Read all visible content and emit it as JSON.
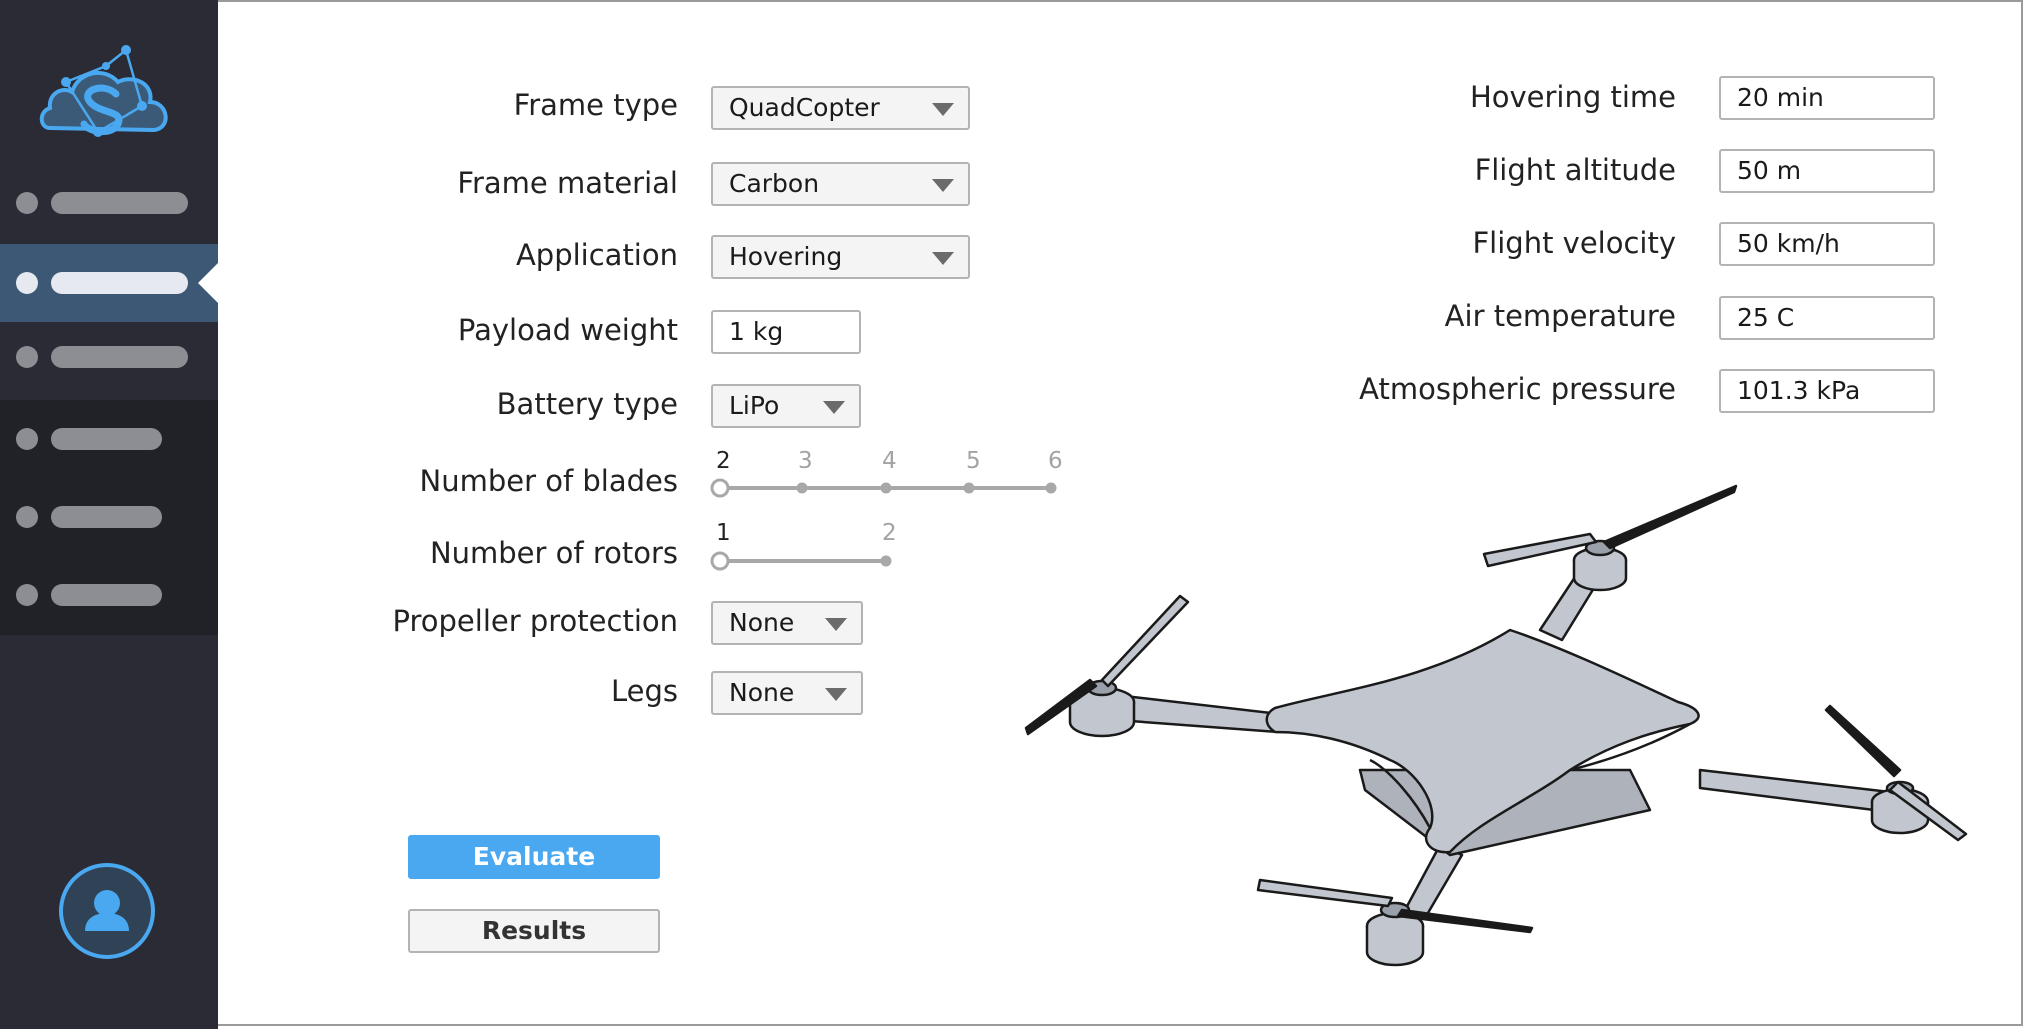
{
  "sidebar": {
    "items": [
      {
        "id": "nav-1",
        "active": false
      },
      {
        "id": "nav-2",
        "active": true
      },
      {
        "id": "nav-3",
        "active": false
      },
      {
        "id": "nav-4",
        "active": false
      },
      {
        "id": "nav-5",
        "active": false
      },
      {
        "id": "nav-6",
        "active": false
      }
    ],
    "accent_color": "#4aa8f0"
  },
  "form": {
    "frame_type": {
      "label": "Frame type",
      "value": "QuadCopter"
    },
    "frame_material": {
      "label": "Frame material",
      "value": "Carbon"
    },
    "application": {
      "label": "Application",
      "value": "Hovering"
    },
    "payload_weight": {
      "label": "Payload weight",
      "value": "1 kg"
    },
    "battery_type": {
      "label": "Battery type",
      "value": "LiPo"
    },
    "number_of_blades": {
      "label": "Number of blades",
      "options": [
        "2",
        "3",
        "4",
        "5",
        "6"
      ],
      "selected": "2"
    },
    "number_of_rotors": {
      "label": "Number of rotors",
      "options": [
        "1",
        "2"
      ],
      "selected": "1"
    },
    "propeller_protection": {
      "label": "Propeller protection",
      "value": "None"
    },
    "legs": {
      "label": "Legs",
      "value": "None"
    }
  },
  "conditions": {
    "hovering_time": {
      "label": "Hovering time",
      "value": "20 min"
    },
    "flight_altitude": {
      "label": "Flight altitude",
      "value": "50 m"
    },
    "flight_velocity": {
      "label": "Flight velocity",
      "value": "50 km/h"
    },
    "air_temperature": {
      "label": "Air temperature",
      "value": "25 C"
    },
    "atmospheric_pressure": {
      "label": "Atmospheric pressure",
      "value": "101.3  kPa"
    }
  },
  "actions": {
    "evaluate_label": "Evaluate",
    "results_label": "Results"
  },
  "icons": {
    "logo": "cloud-network-logo",
    "avatar": "user-icon",
    "dropdown": "chevron-down-icon"
  }
}
